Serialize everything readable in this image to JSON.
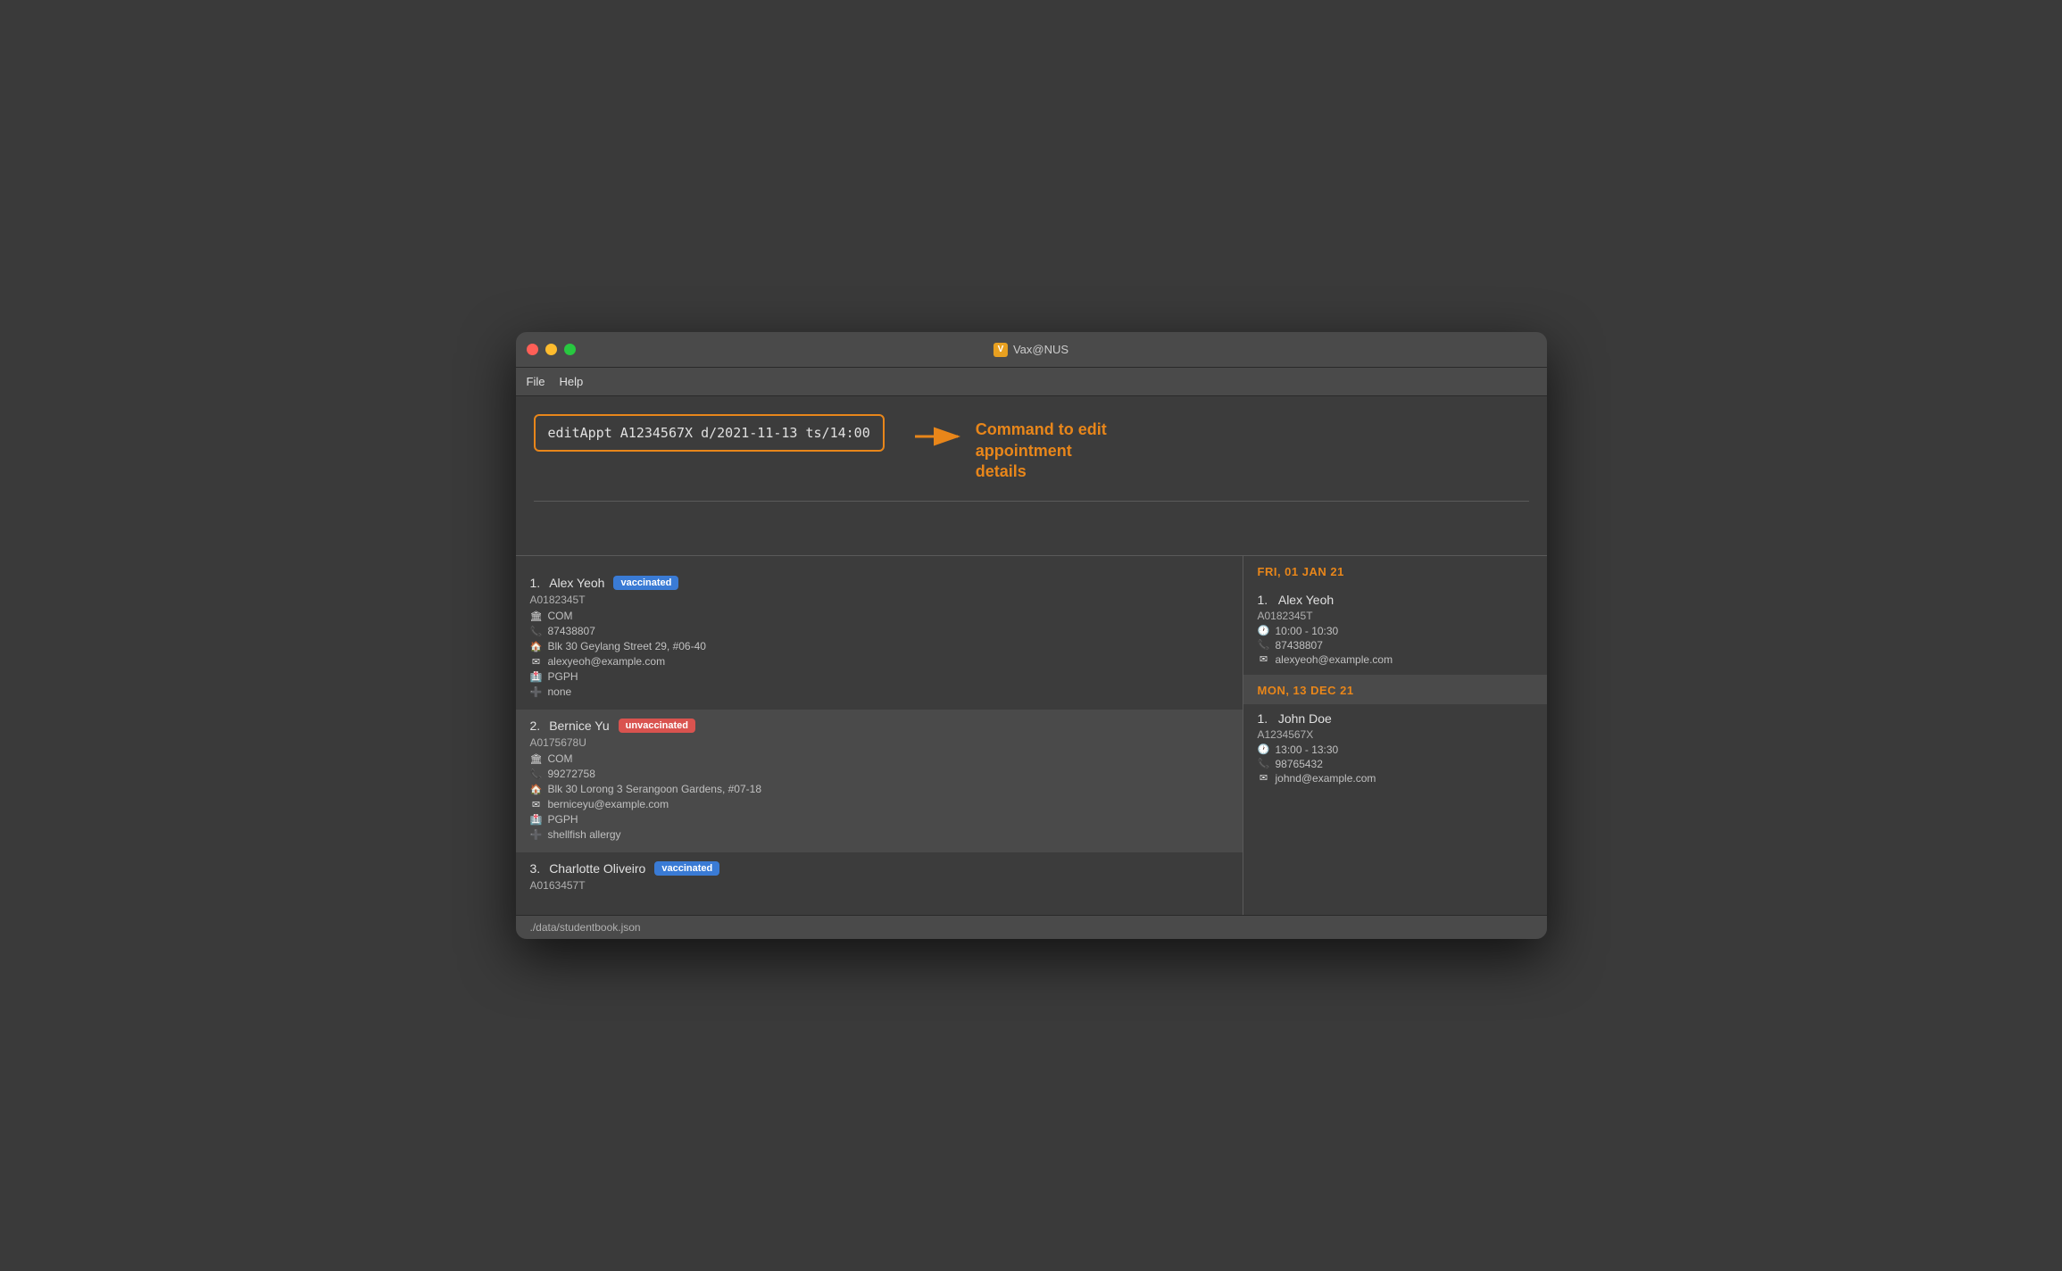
{
  "window": {
    "title": "Vax@NUS",
    "title_icon": "V"
  },
  "menu": {
    "items": [
      "File",
      "Help"
    ]
  },
  "command": {
    "input_text": "editAppt A1234567X d/2021-11-13 ts/14:00",
    "annotation_line1": "Command to edit",
    "annotation_line2": "appointment",
    "annotation_line3": "details"
  },
  "patients": [
    {
      "number": "1.",
      "name": "Alex Yeoh",
      "badge": "vaccinated",
      "badge_type": "vaccinated",
      "id": "A0182345T",
      "faculty": "COM",
      "phone": "87438807",
      "address": "Blk 30 Geylang Street 29, #06-40",
      "email": "alexyeoh@example.com",
      "clinic": "PGPH",
      "status": "none",
      "selected": false
    },
    {
      "number": "2.",
      "name": "Bernice Yu",
      "badge": "unvaccinated",
      "badge_type": "unvaccinated",
      "id": "A0175678U",
      "faculty": "COM",
      "phone": "99272758",
      "address": "Blk 30 Lorong 3 Serangoon Gardens, #07-18",
      "email": "berniceyu@example.com",
      "clinic": "PGPH",
      "status": "shellfish allergy",
      "selected": true
    },
    {
      "number": "3.",
      "name": "Charlotte Oliveiro",
      "badge": "vaccinated",
      "badge_type": "vaccinated",
      "id": "A0163457T",
      "faculty": "",
      "phone": "",
      "address": "",
      "email": "",
      "clinic": "",
      "status": "",
      "selected": false
    }
  ],
  "appointments": [
    {
      "date_label": "FRI, 01 JAN 21",
      "entries": [
        {
          "number": "1.",
          "name": "Alex Yeoh",
          "id": "A0182345T",
          "time": "10:00 - 10:30",
          "phone": "87438807",
          "email": "alexyeoh@example.com"
        }
      ]
    },
    {
      "date_label": "MON, 13 DEC 21",
      "entries": [
        {
          "number": "1.",
          "name": "John Doe",
          "id": "A1234567X",
          "time": "13:00 - 13:30",
          "phone": "98765432",
          "email": "johnd@example.com"
        }
      ]
    }
  ],
  "status_bar": {
    "text": "./data/studentbook.json"
  },
  "icons": {
    "building": "🏛",
    "phone": "📞",
    "home": "🏠",
    "email": "✉",
    "clinic": "🏥",
    "medical": "➕",
    "clock": "🕐"
  }
}
